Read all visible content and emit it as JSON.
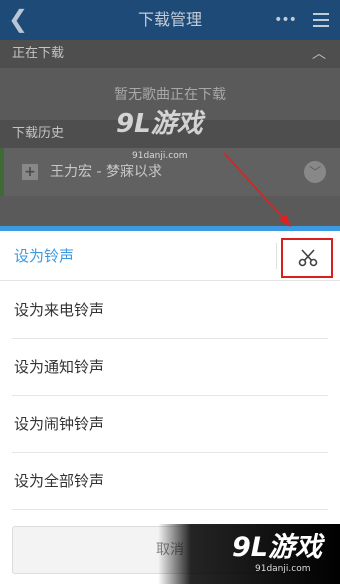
{
  "topbar": {
    "title": "下载管理",
    "back_icon": "chevron-left-icon",
    "more_icon": "more-dots-icon",
    "menu_icon": "hamburger-menu-icon"
  },
  "downloading": {
    "header": "正在下载",
    "empty_text": "暂无歌曲正在下载"
  },
  "history": {
    "header": "下载历史",
    "items": [
      {
        "title": "王力宏 - 梦寐以求"
      }
    ]
  },
  "sheet": {
    "title": "设为铃声",
    "cut_icon": "scissors-icon",
    "options": [
      {
        "label": "设为来电铃声"
      },
      {
        "label": "设为通知铃声"
      },
      {
        "label": "设为闹钟铃声"
      },
      {
        "label": "设为全部铃声"
      }
    ],
    "cancel_label": "取消"
  },
  "watermark": {
    "logo": "9L游戏",
    "url": "91danji.com"
  },
  "colors": {
    "accent": "#3b9ae0",
    "highlight": "#d9201f",
    "topbar": "#1e4a78"
  }
}
